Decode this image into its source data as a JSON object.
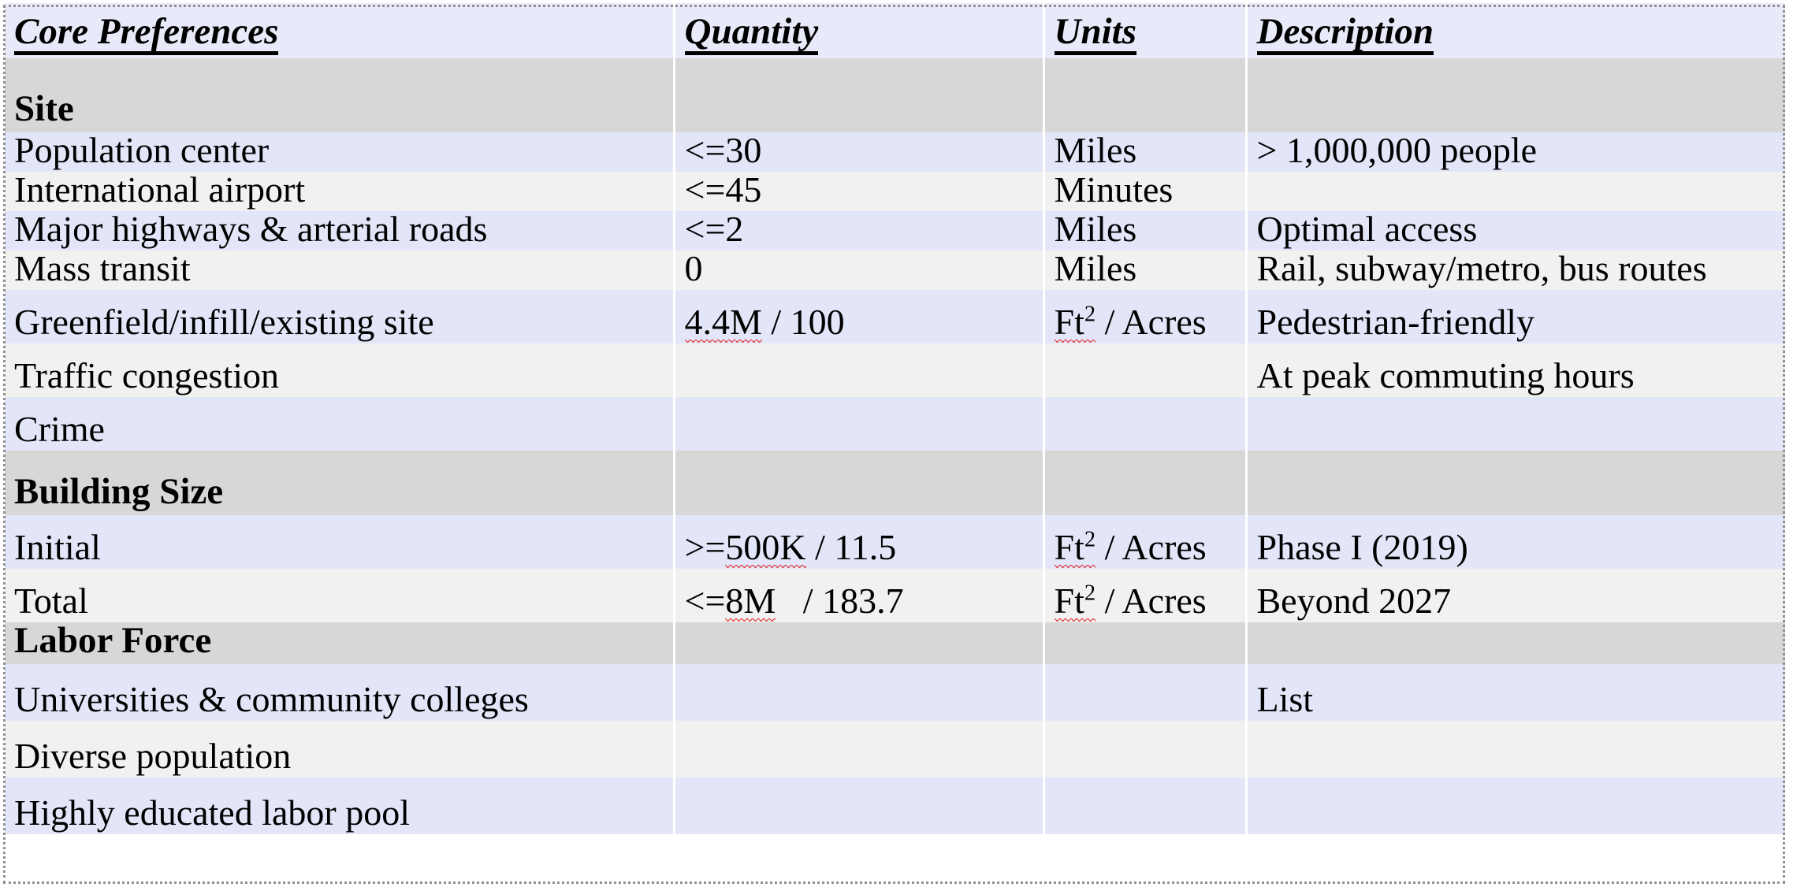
{
  "document": {
    "title": "Core Preferences",
    "kind": "spreadsheet-table"
  },
  "colors": {
    "header_background": "#e8eaf9",
    "section_background": "#d7d7d7",
    "row_odd_background": "#e3e6f8",
    "row_even_background": "#f1f1f0",
    "text": "#000000",
    "spellcheck_underline": "#e03030",
    "frame_border": "#8f8f8f"
  },
  "table": {
    "columns": [
      {
        "key": "preference",
        "label": "Core Preferences"
      },
      {
        "key": "quantity",
        "label": "Quantity"
      },
      {
        "key": "units",
        "label": "Units"
      },
      {
        "key": "description",
        "label": "Description"
      }
    ],
    "rows": [
      {
        "type": "section",
        "preference": "Site",
        "quantity": "",
        "units": "",
        "description": ""
      },
      {
        "type": "data",
        "preference": "Population center",
        "quantity": "<=30",
        "units": "Miles",
        "description": "> 1,000,000 people"
      },
      {
        "type": "data",
        "preference": "International airport",
        "quantity": "<=45",
        "units": "Minutes",
        "description": ""
      },
      {
        "type": "data",
        "preference": "Major highways & arterial roads",
        "quantity": "<=2",
        "units": "Miles",
        "description": "Optimal access"
      },
      {
        "type": "data",
        "preference": "Mass transit",
        "quantity": "0",
        "units": "Miles",
        "description": "Rail, subway/metro, bus routes"
      },
      {
        "type": "data",
        "preference": "Greenfield/infill/existing site",
        "quantity": "4.4M / 100",
        "units": "Ft2 / Acres",
        "description": "Pedestrian-friendly"
      },
      {
        "type": "data",
        "preference": "Traffic congestion",
        "quantity": "",
        "units": "",
        "description": "At peak commuting hours"
      },
      {
        "type": "data",
        "preference": "Crime",
        "quantity": "",
        "units": "",
        "description": ""
      },
      {
        "type": "section",
        "preference": "Building Size",
        "quantity": "",
        "units": "",
        "description": ""
      },
      {
        "type": "data",
        "preference": "Initial",
        "quantity": ">=500K / 11.5",
        "units": "Ft2 / Acres",
        "description": "Phase I (2019)"
      },
      {
        "type": "data",
        "preference": "Total",
        "quantity": "<=8M   / 183.7",
        "units": "Ft2 / Acres",
        "description": "Beyond 2027"
      },
      {
        "type": "section",
        "preference": "Labor Force",
        "quantity": "",
        "units": "",
        "description": ""
      },
      {
        "type": "data",
        "preference": "Universities & community colleges",
        "quantity": "",
        "units": "",
        "description": "List"
      },
      {
        "type": "data",
        "preference": "Diverse population",
        "quantity": "",
        "units": "",
        "description": ""
      },
      {
        "type": "data",
        "preference": "Highly educated labor pool",
        "quantity": "",
        "units": "",
        "description": ""
      }
    ]
  },
  "cells": {
    "h_pref": "Core Preferences",
    "h_qty": "Quantity",
    "h_units": "Units",
    "h_desc": "Description",
    "sec_site": "Site",
    "sec_building": "Building Size",
    "sec_labor": "Labor Force",
    "r1_pref": "Population center",
    "r1_qty": "<=30",
    "r1_units": "Miles",
    "r1_desc": "> 1,000,000 people",
    "r2_pref": "International airport",
    "r2_qty": "<=45",
    "r2_units": "Minutes",
    "r2_desc": "",
    "r3_pref": "Major highways & arterial roads",
    "r3_qty": "<=2",
    "r3_units": "Miles",
    "r3_desc": "Optimal access",
    "r4_pref": "Mass transit",
    "r4_qty": "0",
    "r4_units": "Miles",
    "r4_desc": "Rail, subway/metro, bus routes",
    "r5_pref": "Greenfield/infill/existing site",
    "r5_qty_num": "4.4M",
    "r5_qty_rest": " / 100",
    "r5_units_ft": "Ft",
    "r5_units_sup": "2",
    "r5_units_rest": " / Acres",
    "r5_desc": "Pedestrian-friendly",
    "r6_pref": "Traffic congestion",
    "r6_qty": "",
    "r6_units": "",
    "r6_desc": "At peak commuting hours",
    "r7_pref": "Crime",
    "r7_qty": "",
    "r7_units": "",
    "r7_desc": "",
    "r8_pref": "Initial",
    "r8_qty_pre": ">=",
    "r8_qty_num": "500K",
    "r8_qty_rest": " / 11.5",
    "r8_units_ft": "Ft",
    "r8_units_sup": "2",
    "r8_units_rest": " / Acres",
    "r8_desc": "Phase I (2019)",
    "r9_pref": "Total",
    "r9_qty_pre": "<=",
    "r9_qty_num": "8M",
    "r9_qty_rest": "   / 183.7",
    "r9_units_ft": "Ft",
    "r9_units_sup": "2",
    "r9_units_rest": " / Acres",
    "r9_desc": "Beyond 2027",
    "r10_pref": "Universities & community colleges",
    "r10_qty": "",
    "r10_units": "",
    "r10_desc": "List",
    "r11_pref": "Diverse population",
    "r11_qty": "",
    "r11_units": "",
    "r11_desc": "",
    "r12_pref": "Highly educated labor pool",
    "r12_qty": "",
    "r12_units": "",
    "r12_desc": ""
  }
}
